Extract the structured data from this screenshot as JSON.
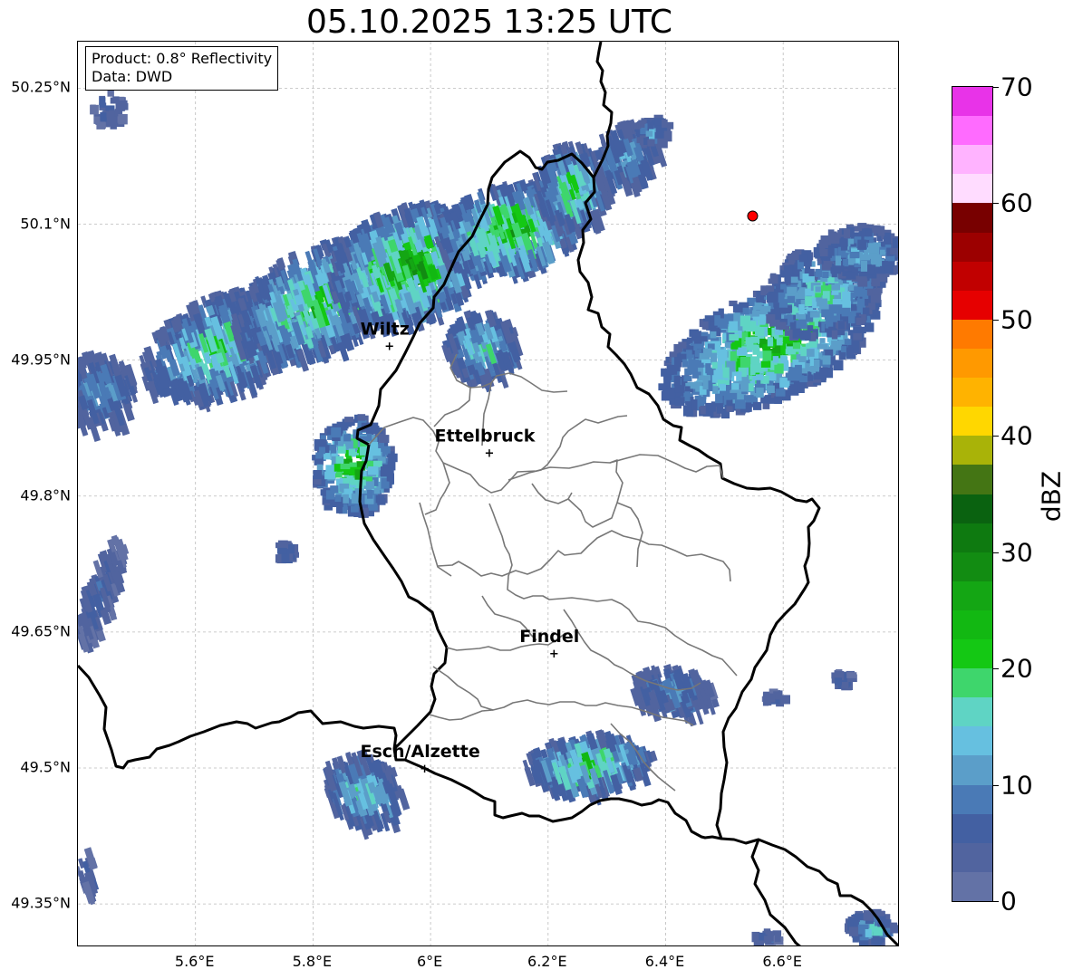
{
  "title": "05.10.2025 13:25 UTC",
  "info": {
    "product": "Product: 0.8° Reflectivity",
    "source": "Data: DWD"
  },
  "lat_ticks": [
    {
      "value": 50.25,
      "label": "50.25°N"
    },
    {
      "value": 50.1,
      "label": "50.1°N"
    },
    {
      "value": 49.95,
      "label": "49.95°N"
    },
    {
      "value": 49.8,
      "label": "49.8°N"
    },
    {
      "value": 49.65,
      "label": "49.65°N"
    },
    {
      "value": 49.5,
      "label": "49.5°N"
    },
    {
      "value": 49.35,
      "label": "49.35°N"
    }
  ],
  "lon_ticks": [
    {
      "value": 5.6,
      "label": "5.6°E"
    },
    {
      "value": 5.8,
      "label": "5.8°E"
    },
    {
      "value": 6.0,
      "label": "6°E"
    },
    {
      "value": 6.2,
      "label": "6.2°E"
    },
    {
      "value": 6.4,
      "label": "6.4°E"
    },
    {
      "value": 6.6,
      "label": "6.6°E"
    }
  ],
  "cities": [
    {
      "name": "Wiltz",
      "lon": 5.93,
      "lat": 49.966
    },
    {
      "name": "Ettelbruck",
      "lon": 6.1,
      "lat": 49.848
    },
    {
      "name": "Findel",
      "lon": 6.21,
      "lat": 49.627
    },
    {
      "name": "Esch/Alzette",
      "lon": 5.99,
      "lat": 49.5
    }
  ],
  "radar_site": {
    "lon": 6.548,
    "lat": 50.109,
    "color": "#ff0000"
  },
  "colorbar": {
    "label": "dBZ",
    "min": 0,
    "max": 70,
    "step": 2.5,
    "tick_values": [
      0,
      10,
      20,
      30,
      40,
      50,
      60,
      70
    ],
    "tick_labels": [
      "0",
      "10",
      "20",
      "30",
      "40",
      "50",
      "60",
      "70"
    ],
    "colors": [
      "#6372a6",
      "#51649f",
      "#4360a2",
      "#4a7ab6",
      "#5b9ec9",
      "#66c0e0",
      "#5fd4c4",
      "#3ed66c",
      "#14c814",
      "#12b812",
      "#14a614",
      "#128c12",
      "#0e7a10",
      "#0a6210",
      "#447514",
      "#a9b308",
      "#ffd700",
      "#ffb300",
      "#ff9900",
      "#ff7a00",
      "#e60000",
      "#c10000",
      "#9c0000",
      "#780000",
      "#ffdcff",
      "#ffb3ff",
      "#ff6bff",
      "#e833e8"
    ]
  }
}
